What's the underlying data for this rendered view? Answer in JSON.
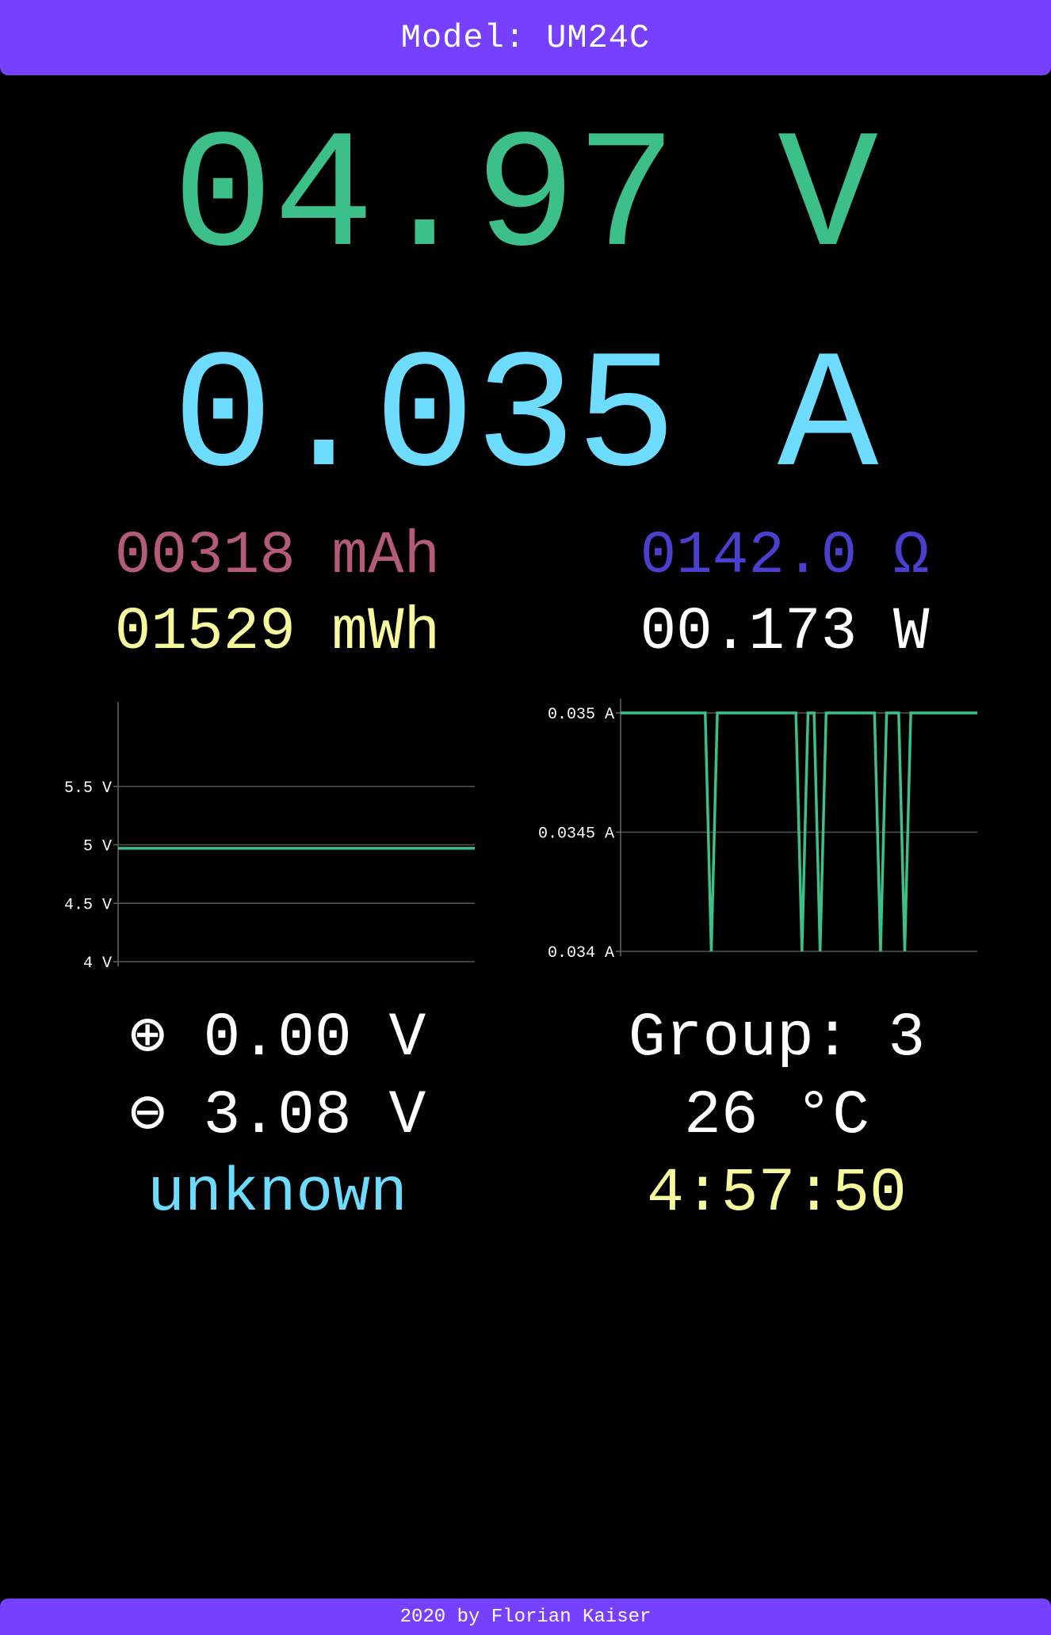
{
  "header": {
    "model": "Model: UM24C"
  },
  "readings": {
    "voltage": "04.97 V",
    "current": "0.035 A",
    "capacity": "00318 mAh",
    "energy": "01529 mWh",
    "resistance": "0142.0 Ω",
    "power": "00.173 W"
  },
  "data_lines": {
    "plus": "⊕ 0.00 V",
    "minus": "⊖ 3.08 V",
    "mode": "unknown"
  },
  "status": {
    "group": "Group: 3",
    "temperature": "26 °C",
    "time": "4:57:50"
  },
  "footer": {
    "text": "2020 by Florian Kaiser"
  },
  "colors": {
    "accent": "#7540fe",
    "voltage": "#3cbf88",
    "current": "#6ddcfe",
    "capacity": "#b45b79",
    "energy": "#f6fa9c",
    "resistance": "#4a3fcf",
    "line": "#3cbf88",
    "grid": "#555555"
  },
  "chart_data": [
    {
      "type": "line",
      "name": "voltage-history",
      "ylim": [
        4,
        6
      ],
      "y_ticks": [
        {
          "value": 4,
          "label": "4 V"
        },
        {
          "value": 4.5,
          "label": "4.5 V"
        },
        {
          "value": 5,
          "label": "5 V"
        },
        {
          "value": 5.5,
          "label": "5.5 V"
        }
      ],
      "values": [
        4.97,
        4.97,
        4.97,
        4.97,
        4.97,
        4.97,
        4.97,
        4.97,
        4.97,
        4.97,
        4.97,
        4.97,
        4.97,
        4.97,
        4.97,
        4.97,
        4.97,
        4.97,
        4.97,
        4.97,
        4.97,
        4.97,
        4.97,
        4.97,
        4.97,
        4.97,
        4.97,
        4.97,
        4.97,
        4.97,
        4.97,
        4.97,
        4.97,
        4.97,
        4.97,
        4.97,
        4.97,
        4.97,
        4.97,
        4.97,
        4.97,
        4.97,
        4.97,
        4.97,
        4.97,
        4.97,
        4.97,
        4.97,
        4.97,
        4.97,
        4.97,
        4.97,
        4.97,
        4.97,
        4.97,
        4.97,
        4.97,
        4.97,
        4.97,
        4.97
      ],
      "grid": true
    },
    {
      "type": "line",
      "name": "current-history",
      "ylim": [
        0.034,
        0.035
      ],
      "y_ticks": [
        {
          "value": 0.034,
          "label": "0.034 A"
        },
        {
          "value": 0.0345,
          "label": "0.0345 A"
        },
        {
          "value": 0.035,
          "label": "0.035 A"
        }
      ],
      "values": [
        0.035,
        0.035,
        0.035,
        0.035,
        0.035,
        0.035,
        0.035,
        0.035,
        0.035,
        0.035,
        0.035,
        0.035,
        0.035,
        0.035,
        0.035,
        0.034,
        0.035,
        0.035,
        0.035,
        0.035,
        0.035,
        0.035,
        0.035,
        0.035,
        0.035,
        0.035,
        0.035,
        0.035,
        0.035,
        0.035,
        0.034,
        0.035,
        0.035,
        0.034,
        0.035,
        0.035,
        0.035,
        0.035,
        0.035,
        0.035,
        0.035,
        0.035,
        0.035,
        0.034,
        0.035,
        0.035,
        0.035,
        0.034,
        0.035,
        0.035,
        0.035,
        0.035,
        0.035,
        0.035,
        0.035,
        0.035,
        0.035,
        0.035,
        0.035,
        0.035
      ],
      "grid": true
    }
  ]
}
